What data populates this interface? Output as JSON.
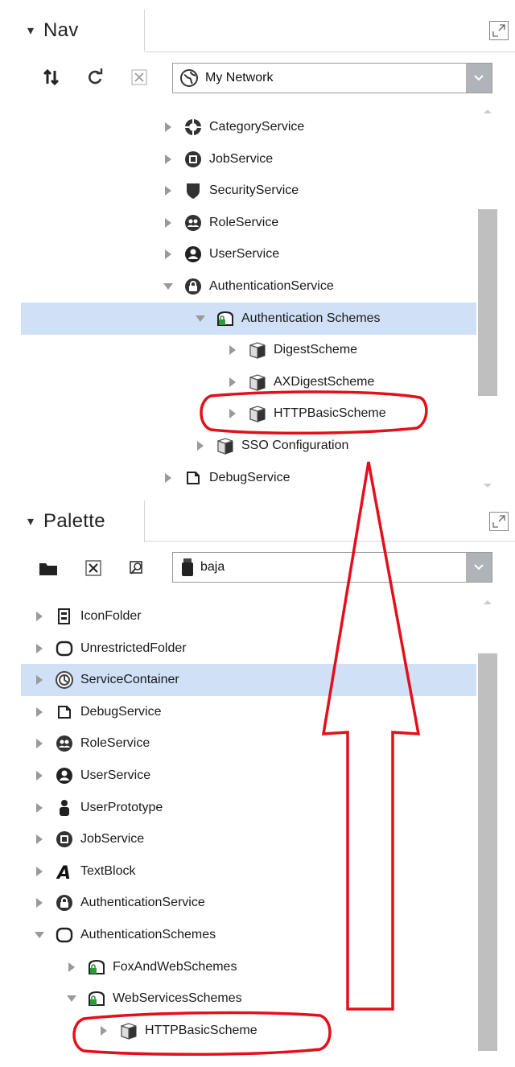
{
  "nav": {
    "tab_label": "Nav",
    "tab_chevron": "▾",
    "toolbar_icons": [
      "sort-arrows-icon",
      "refresh-icon",
      "close-x-icon"
    ],
    "combo_value": "My Network",
    "combo_icon": "globe-icon",
    "tree": [
      {
        "label": "CategoryService",
        "icon": "category-icon",
        "expanded": false,
        "selected": false
      },
      {
        "label": "JobService",
        "icon": "job-icon",
        "expanded": false,
        "selected": false
      },
      {
        "label": "SecurityService",
        "icon": "shield-icon",
        "expanded": false,
        "selected": false
      },
      {
        "label": "RoleService",
        "icon": "role-icon",
        "expanded": false,
        "selected": false
      },
      {
        "label": "UserService",
        "icon": "user-icon",
        "expanded": false,
        "selected": false
      },
      {
        "label": "AuthenticationService",
        "icon": "lock-icon",
        "expanded": true,
        "selected": false
      },
      {
        "label": "Authentication Schemes",
        "icon": "auth-schemes-icon",
        "expanded": true,
        "selected": true
      },
      {
        "label": "DigestScheme",
        "icon": "cube-icon",
        "expanded": false,
        "selected": false
      },
      {
        "label": "AXDigestScheme",
        "icon": "cube-icon",
        "expanded": false,
        "selected": false
      },
      {
        "label": "HTTPBasicScheme",
        "icon": "cube-icon",
        "expanded": false,
        "selected": false
      },
      {
        "label": "SSO Configuration",
        "icon": "cube-icon",
        "expanded": false,
        "selected": false
      },
      {
        "label": "DebugService",
        "icon": "debug-icon",
        "expanded": false,
        "selected": false
      }
    ]
  },
  "palette": {
    "tab_label": "Palette",
    "tab_chevron": "▾",
    "toolbar_icons": [
      "folder-icon",
      "close-x-icon",
      "find-icon"
    ],
    "combo_value": "baja",
    "combo_icon": "jar-icon",
    "tree": [
      {
        "label": "IconFolder",
        "icon": "icon-folder-icon",
        "expanded": false,
        "selected": false
      },
      {
        "label": "UnrestrictedFolder",
        "icon": "folder-outline-icon",
        "expanded": false,
        "selected": false
      },
      {
        "label": "ServiceContainer",
        "icon": "service-container-icon",
        "expanded": false,
        "selected": true
      },
      {
        "label": "DebugService",
        "icon": "debug-icon",
        "expanded": false,
        "selected": false
      },
      {
        "label": "RoleService",
        "icon": "role-icon",
        "expanded": false,
        "selected": false
      },
      {
        "label": "UserService",
        "icon": "user-icon",
        "expanded": false,
        "selected": false
      },
      {
        "label": "UserPrototype",
        "icon": "person-icon",
        "expanded": false,
        "selected": false
      },
      {
        "label": "JobService",
        "icon": "job-icon",
        "expanded": false,
        "selected": false
      },
      {
        "label": "TextBlock",
        "icon": "text-icon",
        "expanded": false,
        "selected": false
      },
      {
        "label": "AuthenticationService",
        "icon": "lock-icon",
        "expanded": false,
        "selected": false
      },
      {
        "label": "AuthenticationSchemes",
        "icon": "folder-outline-icon",
        "expanded": true,
        "selected": false
      },
      {
        "label": "FoxAndWebSchemes",
        "icon": "auth-schemes-icon",
        "expanded": false,
        "selected": false
      },
      {
        "label": "WebServicesSchemes",
        "icon": "auth-schemes-icon",
        "expanded": true,
        "selected": false
      },
      {
        "label": "HTTPBasicScheme",
        "icon": "cube-icon",
        "expanded": false,
        "selected": false
      }
    ]
  },
  "colors": {
    "selection": "#cfe0f7",
    "annotation": "#e3101c",
    "scroll_thumb": "#bfbfbf"
  }
}
